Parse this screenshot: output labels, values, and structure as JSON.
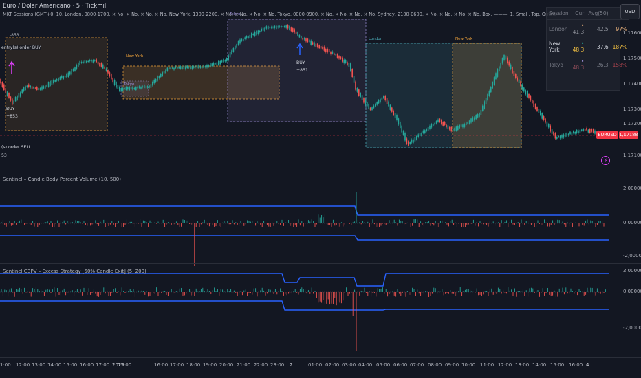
{
  "header": {
    "title": "Euro / Dolar Americano · 5 · Tickmill",
    "indicator_line": "MKT Sessions (GMT+0, 10, London, 0800-1700, × No, × No, × No, × No, New York, 1300-2200, × No, × No, × No, × No, Tokyo, 0000-0900, × No, × No, × No, × No, Sydney, 2100-0600, × No, × No, × No, × No, Box, ———, 1, Small, Top, Outside, 15, small, Session color, High, Low, OHLC, 1, Session color, ———, 1, normal, Pips, 50)"
  },
  "currency_button": "USD",
  "session_table": {
    "headers": [
      "Session",
      "Cur",
      "Avg(50)",
      "%"
    ],
    "rows": [
      {
        "session": "London",
        "dot": "•",
        "cur": "41.3",
        "avg": "42.5",
        "pct": "97%",
        "pct_color": "#f0b67f",
        "active": false
      },
      {
        "session": "New York",
        "dot": "•",
        "cur": "48.3",
        "avg": "37.6",
        "pct": "187%",
        "pct_color": "#f5c242",
        "active": true
      },
      {
        "session": "Tokyo",
        "dot": "•",
        "cur": "48.3",
        "avg": "26.3",
        "pct": "158%",
        "pct_color": "#f23645",
        "active": false
      }
    ]
  },
  "session_labels": {
    "tokyo_top": "Tokyo",
    "new_york_1": "New York",
    "tokyo_small": "Tokyo",
    "london": "London",
    "new_york_2": "New York"
  },
  "trade_labels": {
    "entry_buy": "entry(s) order BUY",
    "top_value": "-853",
    "buy_left": "BUY",
    "buy_left_value": "+853",
    "buy_mid": "BUY",
    "buy_mid_value": "+851",
    "sell": "(s) order SELL",
    "sell_value": "53"
  },
  "price_axis": {
    "ticks": [
      "1,17600",
      "1,17500",
      "1,17400",
      "1,17300",
      "1,17200",
      "1,17100"
    ],
    "current_label": "EURUSD",
    "current_price": "1,17188"
  },
  "indicator1": {
    "label": "Sentinel – Candle Body Percent Volume (10, 500)",
    "ticks": [
      "2,00000",
      "0,00000",
      "-2,00000"
    ]
  },
  "indicator2": {
    "label": "Sentinel CBPV – Excess Strategy [50% Candle Exit] (5, 200)",
    "ticks": [
      "2,00000",
      "0,00000",
      "-2,00000"
    ]
  },
  "time_axis": [
    "1:00",
    "12:00",
    "13:00",
    "14:00",
    "15:00",
    "16:00",
    "17:00",
    "2026",
    "15:00",
    "16:00",
    "17:00",
    "18:00",
    "19:00",
    "20:00",
    "21:00",
    "22:00",
    "23:00",
    "2",
    "01:00",
    "02:00",
    "03:00",
    "04:00",
    "05:00",
    "06:00",
    "07:00",
    "08:00",
    "09:00",
    "10:00",
    "11:00",
    "12:00",
    "13:00",
    "14:00",
    "15:00",
    "16:00",
    "4"
  ],
  "colors": {
    "background": "#131722",
    "up": "#26a69a",
    "down": "#ef5350",
    "band": "#2962ff",
    "london_box": "#4fb3bf",
    "newyork_box": "#f0a33a",
    "tokyo_box": "#9c8fd6"
  }
}
